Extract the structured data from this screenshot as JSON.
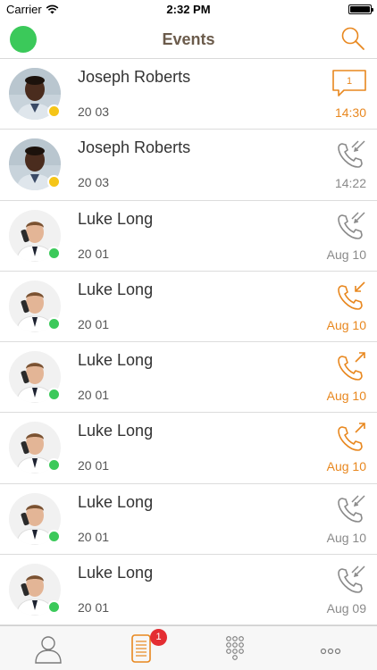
{
  "status_bar": {
    "carrier": "Carrier",
    "time": "2:32 PM"
  },
  "nav": {
    "title": "Events",
    "presence_color": "#3bc95a",
    "accent": "#e8871e"
  },
  "events": [
    {
      "name": "Joseph Roberts",
      "ext": "20 03",
      "time": "14:30",
      "type": "chat",
      "unread": "1",
      "highlight": true,
      "presence": "away",
      "avatar": "joseph"
    },
    {
      "name": "Joseph Roberts",
      "ext": "20 03",
      "time": "14:22",
      "type": "missed",
      "highlight": false,
      "presence": "away",
      "avatar": "joseph"
    },
    {
      "name": "Luke Long",
      "ext": "20 01",
      "time": "Aug 10",
      "type": "missed",
      "highlight": false,
      "presence": "online",
      "avatar": "luke"
    },
    {
      "name": "Luke Long",
      "ext": "20 01",
      "time": "Aug 10",
      "type": "incoming",
      "highlight": true,
      "presence": "online",
      "avatar": "luke"
    },
    {
      "name": "Luke Long",
      "ext": "20 01",
      "time": "Aug 10",
      "type": "outgoing",
      "highlight": true,
      "presence": "online",
      "avatar": "luke"
    },
    {
      "name": "Luke Long",
      "ext": "20 01",
      "time": "Aug 10",
      "type": "outgoing",
      "highlight": true,
      "presence": "online",
      "avatar": "luke"
    },
    {
      "name": "Luke Long",
      "ext": "20 01",
      "time": "Aug 10",
      "type": "missed",
      "highlight": false,
      "presence": "online",
      "avatar": "luke"
    },
    {
      "name": "Luke Long",
      "ext": "20 01",
      "time": "Aug 09",
      "type": "missed",
      "highlight": false,
      "presence": "online",
      "avatar": "luke"
    }
  ],
  "tab_bar": {
    "tabs": [
      {
        "icon": "contacts-icon"
      },
      {
        "icon": "events-icon",
        "badge": "1"
      },
      {
        "icon": "keypad-icon"
      },
      {
        "icon": "more-icon"
      }
    ]
  },
  "colors": {
    "online": "#3bc95a",
    "away": "#f5c518",
    "highlight": "#e8871e",
    "muted": "#8a8a8a",
    "badge": "#e42d32"
  }
}
